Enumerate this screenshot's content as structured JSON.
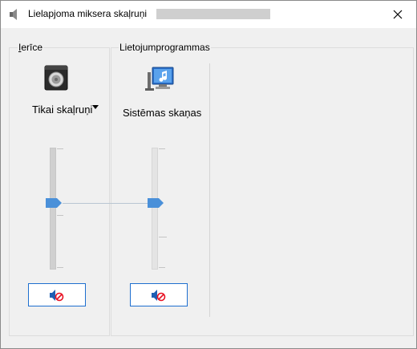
{
  "window": {
    "title": "Lielapjoma miksera skaļruņi"
  },
  "devices_group": {
    "legend_first": "I",
    "legend_rest": "erīce",
    "device_name": "Tikai skaļruņi",
    "volume_level": 0.45,
    "mute_state": "muted"
  },
  "apps_group": {
    "legend": "Lietojumprogrammas",
    "app_name": "Sistēmas skaņas",
    "volume_level": 0.45,
    "mute_state": "muted"
  },
  "colors": {
    "accent": "#1e6fcf",
    "slider_thumb": "#4a90d9",
    "mute_red": "#e81123"
  },
  "icons": [
    "speaker-icon",
    "close-icon",
    "speaker-device-icon",
    "system-sounds-icon",
    "speaker-muted-icon"
  ]
}
